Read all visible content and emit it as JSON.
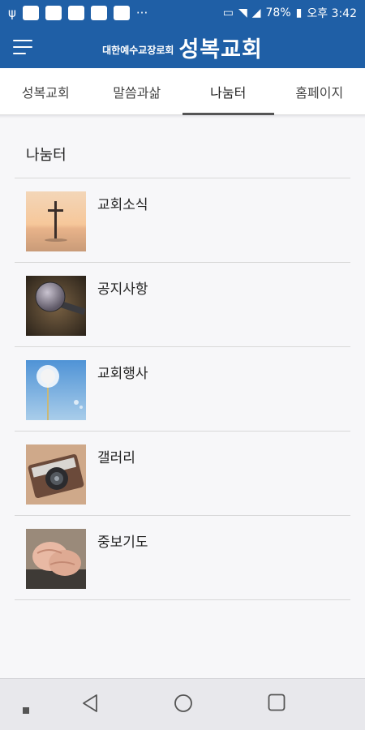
{
  "status_bar": {
    "battery": "78%",
    "time": "오후 3:42"
  },
  "app_bar": {
    "subtitle": "대한예수교장로회",
    "title": "성복교회"
  },
  "tabs": [
    {
      "label": "성복교회",
      "active": false
    },
    {
      "label": "말씀과삶",
      "active": false
    },
    {
      "label": "나눔터",
      "active": true
    },
    {
      "label": "홈페이지",
      "active": false
    }
  ],
  "section": {
    "title": "나눔터"
  },
  "items": [
    {
      "label": "교회소식",
      "image": "cross-sunset"
    },
    {
      "label": "공지사항",
      "image": "microphone"
    },
    {
      "label": "교회행사",
      "image": "dandelion"
    },
    {
      "label": "갤러리",
      "image": "camera"
    },
    {
      "label": "중보기도",
      "image": "praying-hands"
    }
  ],
  "colors": {
    "primary": "#1f5fa6",
    "background": "#f7f7f9"
  }
}
